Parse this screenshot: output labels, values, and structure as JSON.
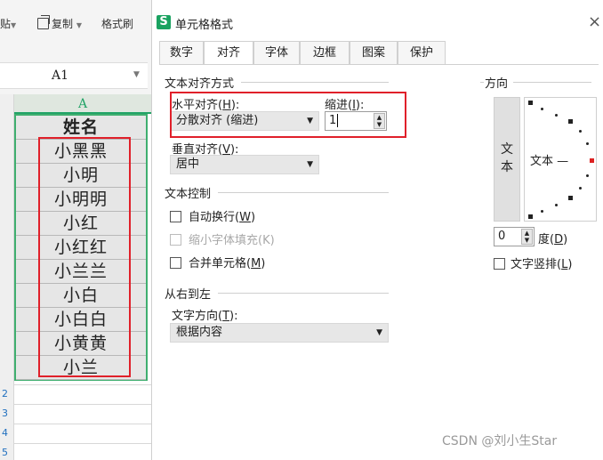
{
  "ribbon": {
    "paste": "贴",
    "copy": "复制",
    "format_painter": "格式刷"
  },
  "namebox": {
    "ref": "A1"
  },
  "sheet": {
    "column_header": "A",
    "header_cell": "姓名",
    "names": [
      "小黑黑",
      "小明",
      "小明明",
      "小红",
      "小红红",
      "小兰兰",
      "小白",
      "小白白",
      "小黄黄",
      "小兰"
    ],
    "row_numbers_below": [
      "2",
      "3",
      "4",
      "5"
    ]
  },
  "dialog": {
    "logo": "S",
    "title": "单元格格式",
    "close": "×",
    "tabs": [
      "数字",
      "对齐",
      "字体",
      "边框",
      "图案",
      "保护"
    ],
    "active_tab": "对齐",
    "text_alignment_section": "文本对齐方式",
    "horizontal_label": "水平对齐(",
    "horizontal_key": "H",
    "horizontal_value": "分散对齐 (缩进)",
    "indent_label": "缩进(",
    "indent_key": "I",
    "indent_value": "1",
    "vertical_label": "垂直对齐(",
    "vertical_key": "V",
    "vertical_value": "居中",
    "text_control_section": "文本控制",
    "wrap_text": "自动换行(",
    "wrap_key": "W",
    "shrink_to_fit": "缩小字体填充(K)",
    "merge_cells": "合并单元格(",
    "merge_key": "M",
    "rtl_section": "从右到左",
    "text_direction_label": "文字方向(",
    "text_direction_key": "T",
    "text_direction_value": "根据内容",
    "orientation_section": "方向",
    "vertical_text": "文\n本",
    "dial_text": "文本 —",
    "degree_value": "0",
    "degree_label": "度(",
    "degree_key": "D",
    "vertical_stack": "文字竖排(",
    "vertical_stack_key": "L"
  },
  "watermark": "CSDN @刘小生Star",
  "colors": {
    "highlight": "#e0202a",
    "selection": "#21a366",
    "logo": "#1aa260"
  }
}
